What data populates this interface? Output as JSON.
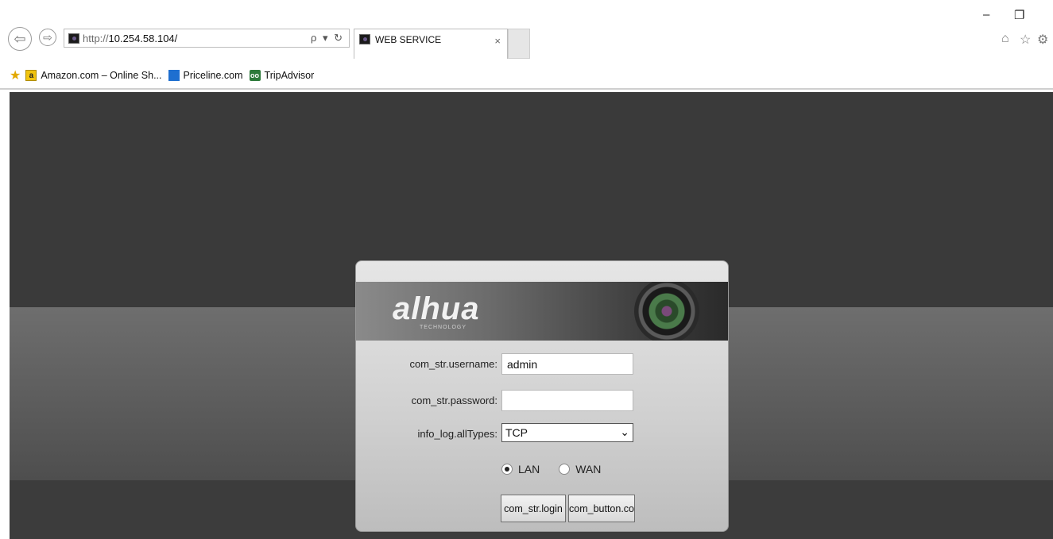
{
  "browser": {
    "url_scheme": "http://",
    "url_host": "10.254.58.104/",
    "tab_title": "WEB SERVICE",
    "address_tools": "ρ ▾ ↻",
    "tab_close": "×",
    "window_controls": {
      "minimize": "–",
      "restore": "❐"
    },
    "toolbar_icons": {
      "home": "⌂",
      "favorites": "☆",
      "settings": "⚙"
    },
    "favorites": [
      {
        "label": "Amazon.com – Online Sh...",
        "icon": "a"
      },
      {
        "label": "Priceline.com",
        "icon": ""
      },
      {
        "label": "TripAdvisor",
        "icon": "oo"
      }
    ]
  },
  "login": {
    "logo": "alhua",
    "logo_sub": "TECHNOLOGY",
    "username_label": "com_str.username:",
    "username_value": "admin",
    "password_label": "com_str.password:",
    "password_value": "",
    "type_label": "info_log.allTypes:",
    "type_value": "TCP",
    "radio_lan": "LAN",
    "radio_wan": "WAN",
    "login_button": "com_str.login",
    "cancel_button": "com_button.co"
  }
}
